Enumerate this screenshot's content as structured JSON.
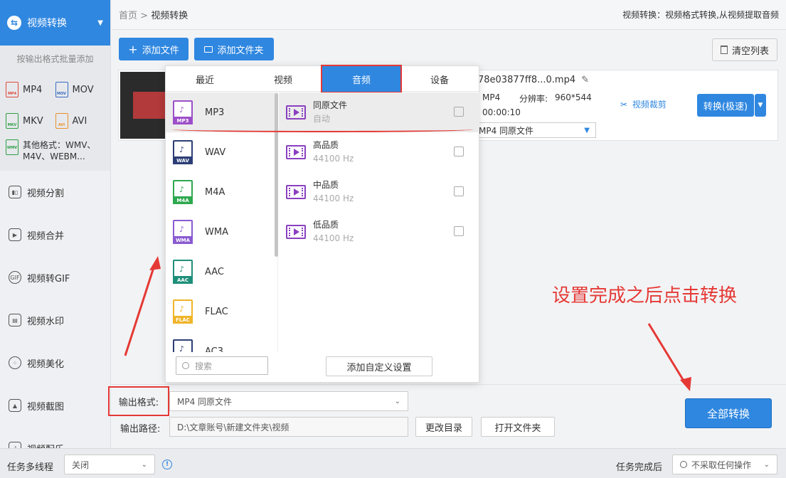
{
  "sidebar": {
    "header": "视频转换",
    "subtitle": "按输出格式批量添加",
    "formats": [
      "MP4",
      "MOV",
      "MKV",
      "AVI"
    ],
    "other_formats": "其他格式：WMV、M4V、WEBM...",
    "items": [
      "视频分割",
      "视频合并",
      "视频转GIF",
      "视频水印",
      "视频美化",
      "视频截图",
      "视频配乐"
    ]
  },
  "topbar": {
    "home": "首页",
    "sep": ">",
    "current": "视频转换",
    "hint": "视频转换：视频格式转换,从视频提取音频"
  },
  "toolbar": {
    "add_file": "添加文件",
    "add_folder": "添加文件夹",
    "clear_list": "清空列表"
  },
  "file": {
    "name": "78e03877ff8...0.mp4",
    "format": "MP4",
    "resolution_label": "分辨率:",
    "resolution": "960*544",
    "duration": "00:00:10",
    "output_select": "MP4  同原文件",
    "crop_label": "视频裁剪",
    "convert_fast": "转换(极速)"
  },
  "popup": {
    "tabs": [
      "最近",
      "视频",
      "音频",
      "设备"
    ],
    "active_tab": "音频",
    "formats": [
      "MP3",
      "WAV",
      "M4A",
      "WMA",
      "AAC",
      "FLAC",
      "AC3"
    ],
    "qualities": [
      {
        "name": "同原文件",
        "detail": "自动"
      },
      {
        "name": "高品质",
        "detail": "44100 Hz"
      },
      {
        "name": "中品质",
        "detail": "44100 Hz"
      },
      {
        "name": "低品质",
        "detail": "44100 Hz"
      }
    ],
    "search_placeholder": "搜索",
    "custom_button": "添加自定义设置"
  },
  "bottom": {
    "output_format_label": "输出格式:",
    "output_format_value": "MP4  同原文件",
    "output_path_label": "输出路径:",
    "output_path_value": "D:\\文章账号\\新建文件夹\\视频",
    "change_dir": "更改目录",
    "open_folder": "打开文件夹",
    "convert_all": "全部转换"
  },
  "statusbar": {
    "multithread_label": "任务多线程",
    "multithread_value": "关闭",
    "after_label": "任务完成后",
    "after_value": "不采取任何操作"
  },
  "annotation": {
    "text": "设置完成之后点击转换",
    "color": "#e53935"
  },
  "colors": {
    "accent": "#2f87e0",
    "highlight": "#e53935"
  }
}
